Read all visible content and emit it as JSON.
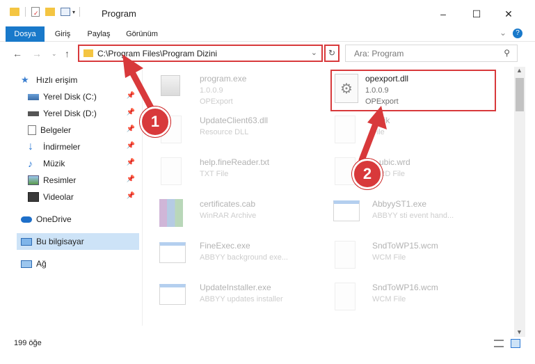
{
  "window": {
    "title": "Program",
    "minimize": "–",
    "maximize": "☐",
    "close": "✕"
  },
  "ribbon": {
    "tabs": [
      "Dosya",
      "Giriş",
      "Paylaş",
      "Görünüm"
    ]
  },
  "address": {
    "path": "C:\\Program Files\\Program Dizini"
  },
  "search": {
    "placeholder": "Ara: Program"
  },
  "sidebar": {
    "items": [
      {
        "label": "Hızlı erişim"
      },
      {
        "label": "Yerel Disk (C:)"
      },
      {
        "label": "Yerel Disk (D:)"
      },
      {
        "label": "Belgeler"
      },
      {
        "label": "İndirmeler"
      },
      {
        "label": "Müzik"
      },
      {
        "label": "Resimler"
      },
      {
        "label": "Videolar"
      },
      {
        "label": "OneDrive"
      },
      {
        "label": "Bu bilgisayar"
      },
      {
        "label": "Ağ"
      }
    ]
  },
  "files": [
    {
      "name": "program.exe",
      "line2": "1.0.0.9",
      "line3": "OPExport"
    },
    {
      "name": "opexport.dll",
      "line2": "1.0.0.9",
      "line3": "OPExport"
    },
    {
      "name": "UpdateClient63.dll",
      "line2": "Resource DLL",
      "line3": ""
    },
    {
      "name": "...ajk",
      "line2": "File",
      "line3": ""
    },
    {
      "name": "help.fineReader.txt",
      "line2": "TXT File",
      "line3": ""
    },
    {
      "name": "...ubic.wrd",
      "line2": "WRD File",
      "line3": ""
    },
    {
      "name": "certificates.cab",
      "line2": "WinRAR Archive",
      "line3": ""
    },
    {
      "name": "AbbyyST1.exe",
      "line2": "ABBYY sti event hand...",
      "line3": ""
    },
    {
      "name": "FineExec.exe",
      "line2": "ABBYY background exe...",
      "line3": ""
    },
    {
      "name": "SndToWP15.wcm",
      "line2": "WCM File",
      "line3": ""
    },
    {
      "name": "UpdateInstaller.exe",
      "line2": "ABBYY updates installer",
      "line3": ""
    },
    {
      "name": "SndToWP16.wcm",
      "line2": "WCM File",
      "line3": ""
    }
  ],
  "status": {
    "count": "199 öğe"
  },
  "badges": {
    "one": "1",
    "two": "2"
  }
}
